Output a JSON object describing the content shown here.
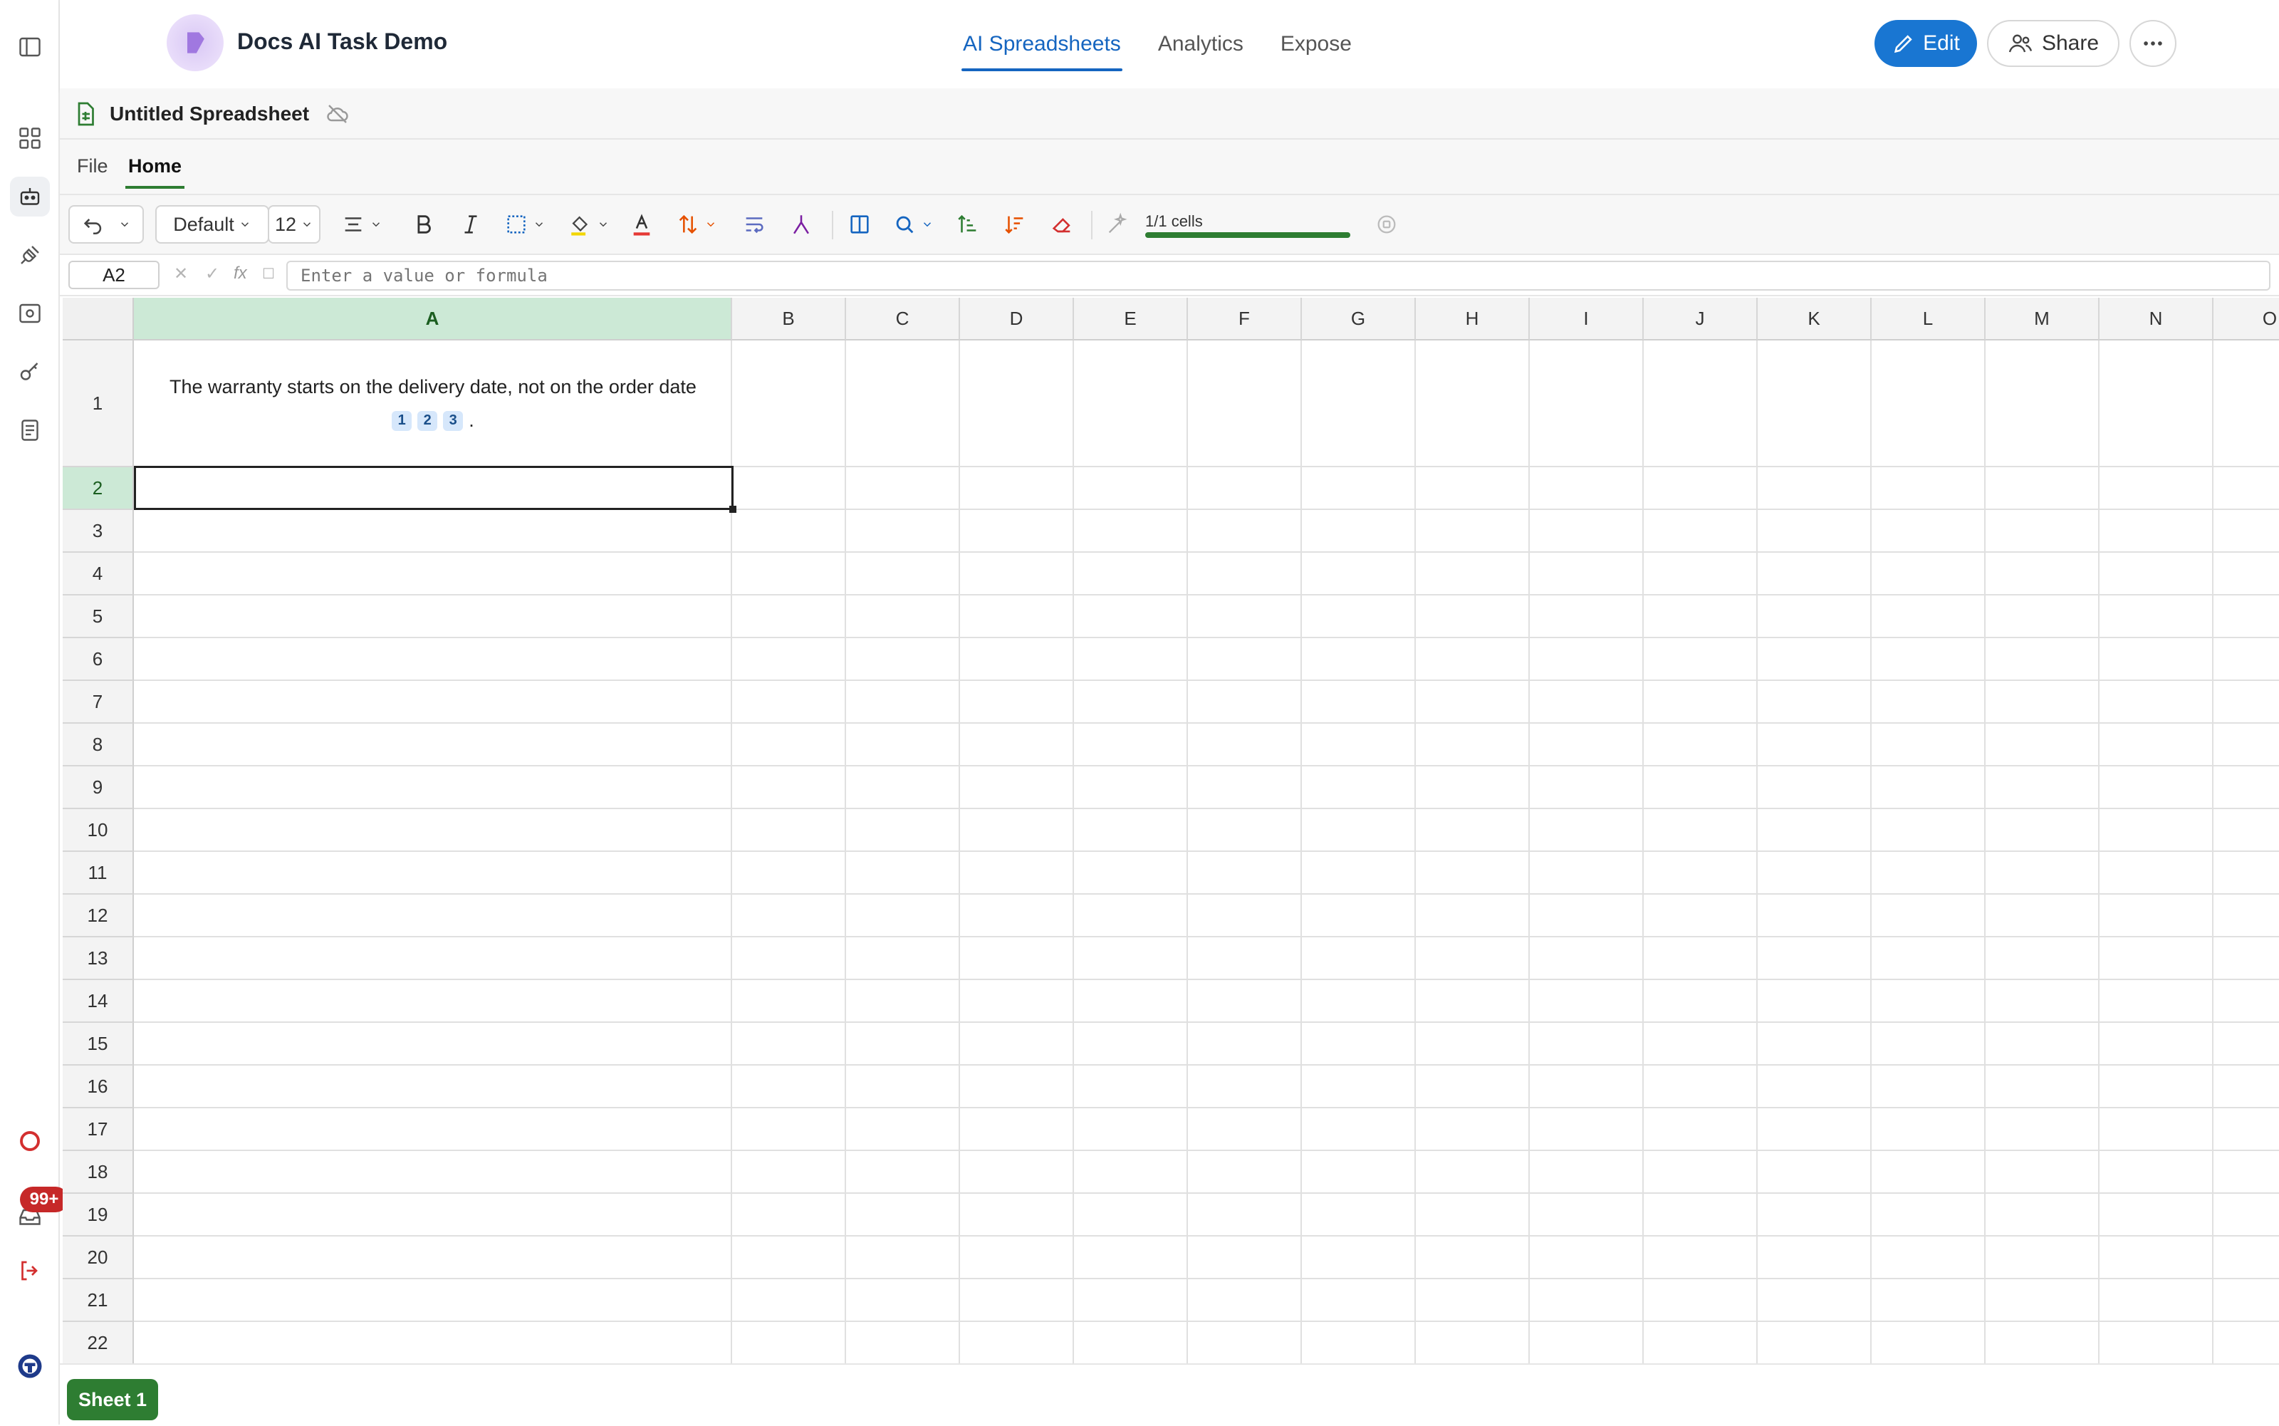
{
  "header": {
    "app_title": "Docs AI Task Demo",
    "nav": [
      {
        "label": "AI Spreadsheets"
      },
      {
        "label": "Analytics"
      },
      {
        "label": "Expose"
      }
    ],
    "edit_label": "Edit",
    "share_label": "Share"
  },
  "document": {
    "title": "Untitled Spreadsheet"
  },
  "menu": {
    "tabs": [
      {
        "label": "File"
      },
      {
        "label": "Home"
      }
    ]
  },
  "toolbar": {
    "font_family": "Default",
    "font_size": "12",
    "progress_label": "1/1 cells",
    "progress_fraction": 1.0
  },
  "formula_bar": {
    "cell_ref": "A2",
    "fx_label": "fx",
    "placeholder": "Enter a value or formula"
  },
  "sidebar": {
    "notification_badge": "99+"
  },
  "grid": {
    "columns": [
      "A",
      "B",
      "C",
      "D",
      "E",
      "F",
      "G",
      "H",
      "I",
      "J",
      "K",
      "L",
      "M",
      "N",
      "O"
    ],
    "rows": [
      "1",
      "2",
      "3",
      "4",
      "5",
      "6",
      "7",
      "8",
      "9",
      "10",
      "11",
      "12",
      "13",
      "14",
      "15",
      "16",
      "17",
      "18",
      "19",
      "20",
      "21",
      "22"
    ],
    "selected_cell": "A2",
    "cells": {
      "A1": {
        "text": "The warranty starts on the delivery date, not on the order date",
        "citations": [
          "1",
          "2",
          "3"
        ],
        "suffix": "."
      }
    }
  },
  "sheets": [
    {
      "label": "Sheet 1"
    }
  ],
  "colors": {
    "accent_blue": "#1976d2",
    "accent_green": "#2e7d32",
    "selected_header": "#cce9d6",
    "badge_red": "#c62828"
  }
}
